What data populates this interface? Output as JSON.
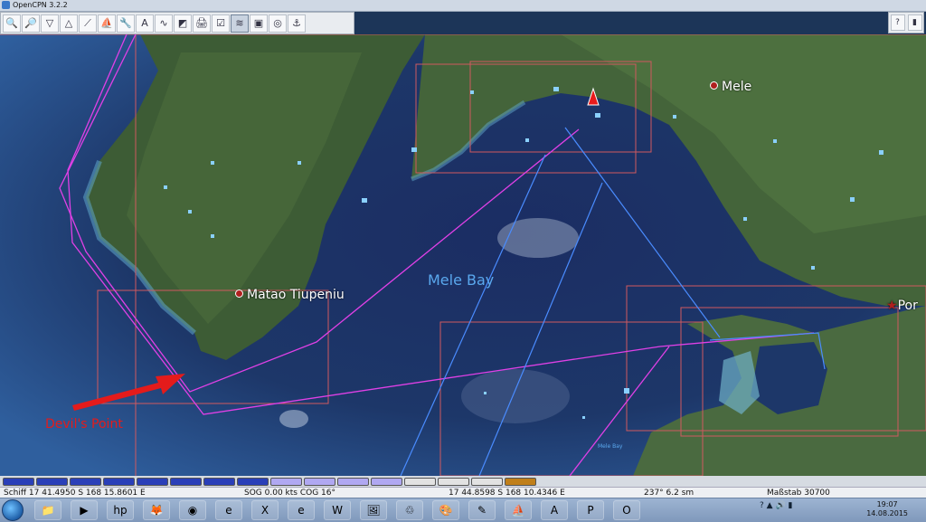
{
  "window": {
    "title": "OpenCPN 3.2.2"
  },
  "toolbar": {
    "tools": [
      {
        "name": "zoom-in-icon",
        "glyph": "🔍"
      },
      {
        "name": "zoom-out-icon",
        "glyph": "🔎"
      },
      {
        "name": "scale-in-icon",
        "glyph": "▽"
      },
      {
        "name": "scale-out-icon",
        "glyph": "△"
      },
      {
        "name": "route-icon",
        "glyph": "⟋"
      },
      {
        "name": "follow-icon",
        "glyph": "⛵"
      },
      {
        "name": "settings-icon",
        "glyph": "🔧"
      },
      {
        "name": "text-icon",
        "glyph": "A"
      },
      {
        "name": "current-icon",
        "glyph": "∿"
      },
      {
        "name": "tides-icon",
        "glyph": "◩"
      },
      {
        "name": "print-icon",
        "glyph": "🖨"
      },
      {
        "name": "chart-quilt-icon",
        "glyph": "☑"
      },
      {
        "name": "track-icon",
        "glyph": "≋"
      },
      {
        "name": "toolbox-icon",
        "glyph": "▣"
      },
      {
        "name": "mob-icon",
        "glyph": "◎"
      },
      {
        "name": "ais-icon",
        "glyph": "⚓"
      }
    ],
    "right_tools": [
      {
        "name": "help-icon",
        "glyph": "?"
      },
      {
        "name": "signal-icon",
        "glyph": "▮"
      }
    ]
  },
  "map": {
    "places": [
      {
        "id": "place-mele",
        "label": "Mele"
      },
      {
        "id": "place-matao",
        "label": "Matao Tiupeniu"
      },
      {
        "id": "place-port",
        "label": "Por"
      }
    ],
    "bay_label": "Mele Bay",
    "bay_label_small": "Mele Bay",
    "annotation": "Devil's Point",
    "colors": {
      "route": "#e040e6",
      "bearing": "#4a8cff",
      "chart_border": "#d0595f",
      "annotation": "#e41b1b"
    }
  },
  "chartbar": {
    "cells": [
      "#2a3fb8",
      "#2a3fb8",
      "#2a3fb8",
      "#2a3fb8",
      "#2a3fb8",
      "#2a3fb8",
      "#2a3fb8",
      "#2a3fb8",
      "#b0a8f2",
      "#b0a8f2",
      "#b0a8f2",
      "#b0a8f2",
      "#e2e2e2",
      "#e2e2e2",
      "#e2e2e2",
      "#c07f1a"
    ]
  },
  "status": {
    "ship": "Schiff 17 41.4950 S   168 15.8601 E",
    "sog": "SOG 0.00 kts   COG 16°",
    "cursor": "17 44.8598 S   168 10.4346 E",
    "bearing": "237°  6.2 sm",
    "scale": "Maßstab 30700"
  },
  "taskbar": {
    "apps": [
      {
        "name": "explorer-icon",
        "glyph": "📁"
      },
      {
        "name": "media-player-icon",
        "glyph": "▶"
      },
      {
        "name": "hp-icon",
        "glyph": "hp"
      },
      {
        "name": "firefox-icon",
        "glyph": "🦊"
      },
      {
        "name": "chrome-icon",
        "glyph": "◉"
      },
      {
        "name": "ie-icon",
        "glyph": "e"
      },
      {
        "name": "excel-icon",
        "glyph": "X"
      },
      {
        "name": "ie2-icon",
        "glyph": "e"
      },
      {
        "name": "word-icon",
        "glyph": "W"
      },
      {
        "name": "image-icon",
        "glyph": "🖼"
      },
      {
        "name": "recycle-icon",
        "glyph": "♲"
      },
      {
        "name": "paint-icon",
        "glyph": "🎨"
      },
      {
        "name": "pen-icon",
        "glyph": "✎"
      },
      {
        "name": "opencpn-icon",
        "glyph": "⛵"
      },
      {
        "name": "acrobat-icon",
        "glyph": "A"
      },
      {
        "name": "pdf-icon",
        "glyph": "P"
      },
      {
        "name": "clipboard-icon",
        "glyph": "O"
      }
    ],
    "time": "19:07",
    "date": "14.08.2015"
  }
}
